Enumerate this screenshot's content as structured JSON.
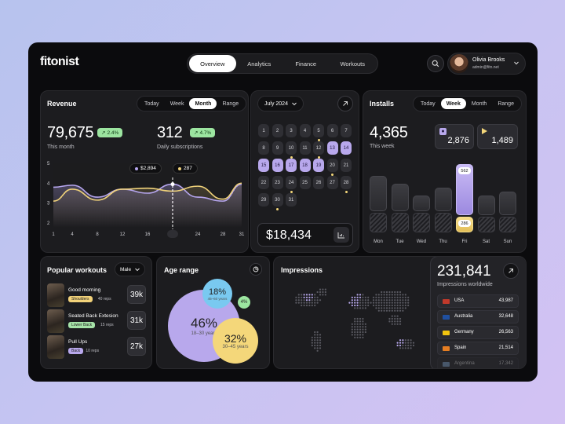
{
  "app": {
    "logo": "fitonist"
  },
  "nav": {
    "tabs": [
      {
        "label": "Overview",
        "active": true
      },
      {
        "label": "Analytics",
        "active": false
      },
      {
        "label": "Finance",
        "active": false
      },
      {
        "label": "Workouts",
        "active": false
      }
    ]
  },
  "user": {
    "name": "Olivia Brooks",
    "email": "admin@fitn.net"
  },
  "revenue": {
    "title": "Revenue",
    "ranges": [
      "Today",
      "Week",
      "Month",
      "Range"
    ],
    "active_range": "Month",
    "total": "79,675",
    "total_change": "2.4%",
    "total_label": "This month",
    "subs": "312",
    "subs_change": "4.7%",
    "subs_label": "Daily subscriptions",
    "tooltip_revenue": "$2,894",
    "tooltip_subs": "287"
  },
  "chart_data": {
    "type": "line",
    "title": "Revenue",
    "x": [
      1,
      4,
      8,
      12,
      16,
      20,
      24,
      28,
      31
    ],
    "xlabel": "",
    "ylabel": "",
    "ylim": [
      2,
      5
    ],
    "grid": false,
    "y_ticks": [
      2,
      3,
      4,
      5
    ],
    "highlight_x": 20,
    "series": [
      {
        "name": "Revenue",
        "color": "#b6a6ee",
        "values": [
          3.8,
          3.9,
          3.3,
          3.7,
          3.5,
          3.95,
          3.3,
          3.1,
          3.95
        ]
      },
      {
        "name": "Subscriptions",
        "color": "#f0d27a",
        "values": [
          3.1,
          3.7,
          3.15,
          3.7,
          3.75,
          3.6,
          3.85,
          3.2,
          4.0
        ]
      }
    ]
  },
  "calendar": {
    "month": "July 2024",
    "rows": [
      [
        "1",
        "2",
        "3",
        "4",
        "5",
        "6",
        "7"
      ],
      [
        "8",
        "9",
        "10",
        "11",
        "12",
        "13",
        "14"
      ],
      [
        "15",
        "16",
        "17",
        "18",
        "19",
        "20",
        "21"
      ],
      [
        "22",
        "23",
        "24",
        "25",
        "26",
        "27",
        "28"
      ],
      [
        "29",
        "30",
        "31"
      ]
    ],
    "selected": [
      "13",
      "14",
      "15",
      "16",
      "17",
      "18",
      "19"
    ],
    "dotted": [
      "5",
      "10",
      "12",
      "20",
      "24",
      "28",
      "30"
    ],
    "amount": "$18,434"
  },
  "installs": {
    "title": "Installs",
    "ranges": [
      "Today",
      "Week",
      "Month",
      "Range"
    ],
    "active_range": "Week",
    "total": "4,365",
    "total_label": "This week",
    "apple": "2,876",
    "play": "1,489",
    "days": [
      {
        "label": "Mon",
        "top": 0.45,
        "bottom": 0.25
      },
      {
        "label": "Tue",
        "top": 0.35,
        "bottom": 0.25
      },
      {
        "label": "Wed",
        "top": 0.2,
        "bottom": 0.25
      },
      {
        "label": "Thu",
        "top": 0.3,
        "bottom": 0.25
      },
      {
        "label": "Fri",
        "top": 0.65,
        "bottom": 0.2,
        "top_value": "562",
        "bottom_value": "286"
      },
      {
        "label": "Sat",
        "top": 0.25,
        "bottom": 0.2
      },
      {
        "label": "Sun",
        "top": 0.3,
        "bottom": 0.2
      }
    ]
  },
  "workouts": {
    "title": "Popular workouts",
    "filter": "Male",
    "items": [
      {
        "name": "Good morning",
        "tag": "Shoulders",
        "tag_color": "#f2d27a",
        "reps": "40 reps",
        "count": "39k"
      },
      {
        "name": "Seated Back Extesion",
        "tag": "Lower Back",
        "tag_color": "#a6e3a8",
        "reps": "15 reps",
        "count": "31k"
      },
      {
        "name": "Pull Ups",
        "tag": "Back",
        "tag_color": "#b8a8ec",
        "reps": "10 reps",
        "count": "27k"
      }
    ]
  },
  "age": {
    "title": "Age range",
    "groups": [
      {
        "pct": "46%",
        "label": "18–30 years",
        "color": "#b8a8ec"
      },
      {
        "pct": "32%",
        "label": "30–45 years",
        "color": "#f4d77a"
      },
      {
        "pct": "18%",
        "label": "45–60 years",
        "color": "#79c9f0"
      },
      {
        "pct": "4%",
        "label": "",
        "color": "#9ce5a0"
      }
    ]
  },
  "impressions": {
    "title": "Impressions",
    "total": "231,841",
    "total_label": "Impressions worldwide",
    "countries": [
      {
        "name": "USA",
        "value": "43,987"
      },
      {
        "name": "Australia",
        "value": "32,648"
      },
      {
        "name": "Germany",
        "value": "26,563"
      },
      {
        "name": "Spain",
        "value": "21,514"
      },
      {
        "name": "Argentina",
        "value": "17,342"
      }
    ]
  }
}
